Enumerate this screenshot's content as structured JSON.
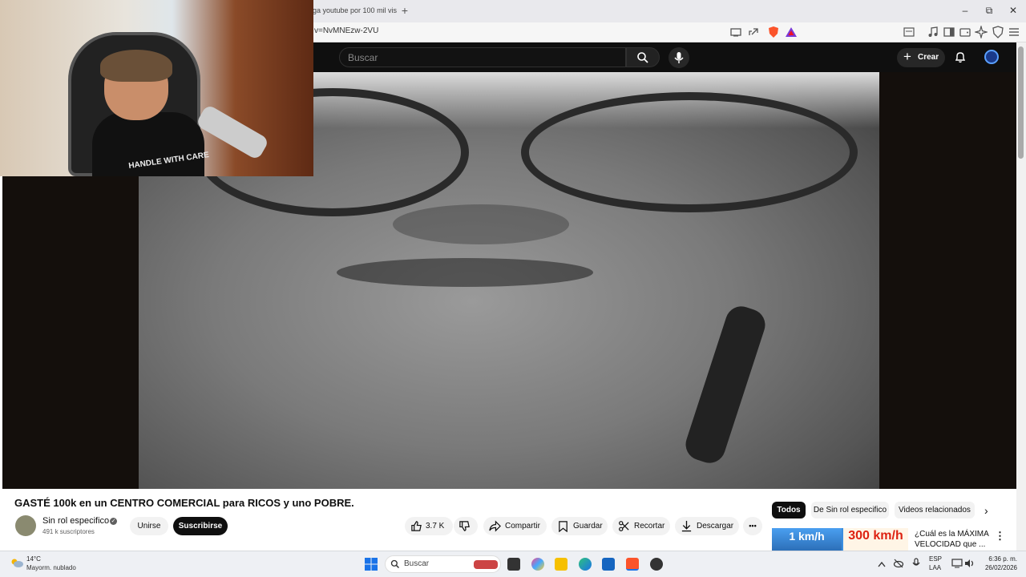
{
  "browser": {
    "tab_title": "ga youtube por 100 mil vis",
    "new_tab": "+",
    "url": "v=NvMNEzw-2VU",
    "window_controls": {
      "minimize": "–",
      "maximize": "⧉",
      "close": "✕"
    }
  },
  "youtube_header": {
    "search_placeholder": "Buscar",
    "create_label": "Crear"
  },
  "webcam": {
    "shirt_text": "HANDLE WITH CARE"
  },
  "video": {
    "title": "GASTÉ 100k en un CENTRO COMERCIAL para RICOS y uno POBRE.",
    "channel_name": "Sin rol especifico",
    "subscribers": "491 k suscriptores",
    "join_label": "Unirse",
    "subscribe_label": "Suscribirse",
    "likes": "3.7 K",
    "share_label": "Compartir",
    "save_label": "Guardar",
    "clip_label": "Recortar",
    "download_label": "Descargar",
    "more_label": "•••"
  },
  "sidebar": {
    "chips": [
      "Todos",
      "De Sin rol especifico",
      "Videos relacionados"
    ],
    "next": "›",
    "related": {
      "thumb_left": "1 km/h",
      "thumb_right": "300 km/h",
      "title": "¿Cuál es la MÁXIMA VELOCIDAD que ...",
      "menu": "⋮"
    }
  },
  "taskbar": {
    "temperature": "14°C",
    "weather": "Mayorm. nublado",
    "search_placeholder": "Buscar",
    "lang_line1": "ESP",
    "lang_line2": "LAA",
    "time": "6:36 p. m.",
    "date": "26/02/2026"
  },
  "colors": {
    "youtube_dark": "#0f0f0f",
    "subscribe_bg": "#0f0f0f",
    "chip_active": "#0f0f0f",
    "pill_bg": "#f2f2f2"
  }
}
